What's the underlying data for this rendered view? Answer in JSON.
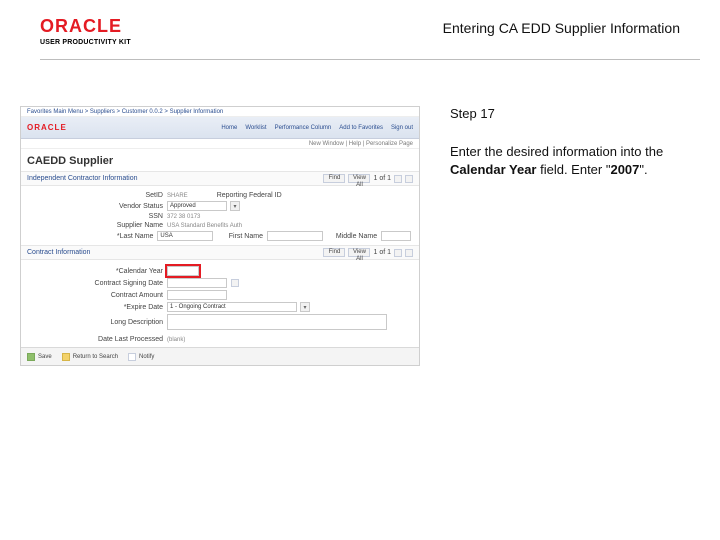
{
  "header": {
    "logo_main": "ORACLE",
    "logo_sub": "USER PRODUCTIVITY KIT",
    "page_title": "Entering CA EDD Supplier Information"
  },
  "instruction": {
    "step_label": "Step 17",
    "line1_a": "Enter the desired information into the ",
    "line1_b": "Calendar Year",
    "line1_c": " field. Enter \"",
    "value": "2007",
    "line1_d": "\"."
  },
  "shot": {
    "breadcrumb": "Favorites   Main Menu > Suppliers > Customer 0.0.2 > Supplier Information",
    "nav_logo": "ORACLE",
    "nav_tabs": [
      "Home",
      "Worklist",
      "Performance Column",
      "Add to Favorites",
      "Sign out"
    ],
    "right_link": "New Window | Help | Personalize Page",
    "title": "CAEDD Supplier",
    "sec1": {
      "header": "Independent Contractor Information",
      "btn_find": "Find",
      "btn_view": "View All",
      "counter": "1 of 1",
      "f_setid_label": "SetID",
      "f_setid_value": "SHARE",
      "f_rfp_label": "Reporting Federal ID",
      "f_vendor_label": "Vendor Status",
      "f_vendor_value": "Approved",
      "f_ssn_label": "SSN",
      "f_ssn_value": "372 38 0173",
      "f_sup_label": "Supplier Name",
      "f_sup_value": "USA Standard Benefits Auth",
      "f_last_label": "*Last Name",
      "f_last_value": "USA",
      "f_first_label": "First Name",
      "f_mid_label": "Middle Name"
    },
    "sec2": {
      "header": "Contract Information",
      "btn_find": "Find",
      "btn_view": "View All",
      "counter": "1 of 1",
      "f_cal_label": "*Calendar Year",
      "f_sign_label": "Contract Signing Date",
      "f_amt_label": "Contract Amount",
      "f_exp_label": "*Expire Date",
      "f_exp_value": "1 - Ongoing Contract",
      "f_long_label": "Long Description",
      "f_date_label": "Date Last Processed",
      "date_hint": "(blank)"
    },
    "footer": {
      "save": "Save",
      "ret": "Return to Search",
      "notify": "Notify"
    }
  }
}
